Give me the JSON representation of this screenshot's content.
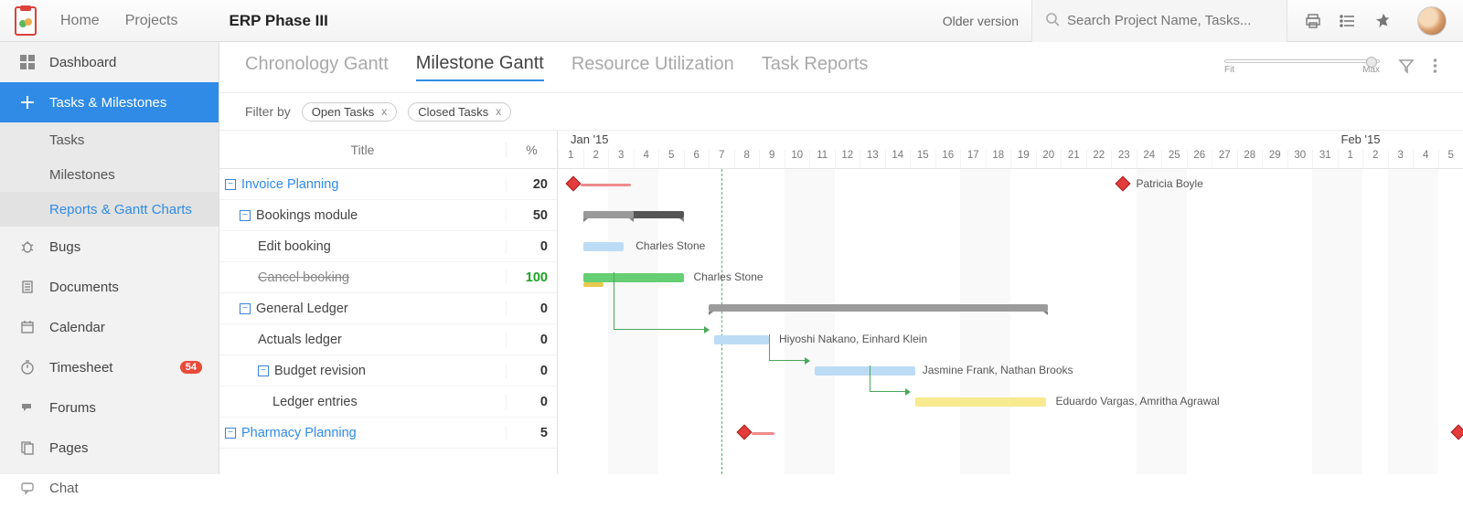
{
  "nav": {
    "home": "Home",
    "projects": "Projects"
  },
  "project_title": "ERP Phase III",
  "older_version": "Older version",
  "search": {
    "placeholder": "Search Project Name, Tasks..."
  },
  "sidebar": {
    "dashboard": "Dashboard",
    "tasks_milestones": "Tasks & Milestones",
    "tasks": "Tasks",
    "milestones": "Milestones",
    "reports_gantt": "Reports & Gantt Charts",
    "bugs": "Bugs",
    "documents": "Documents",
    "calendar": "Calendar",
    "timesheet": "Timesheet",
    "timesheet_badge": "54",
    "forums": "Forums",
    "pages": "Pages",
    "chat": "Chat"
  },
  "view_tabs": {
    "chronology": "Chronology Gantt",
    "milestone": "Milestone Gantt",
    "resource": "Resource Utilization",
    "task_reports": "Task Reports"
  },
  "zoom": {
    "fit": "Fit",
    "max": "Max"
  },
  "filters": {
    "label": "Filter by",
    "open_tasks": "Open Tasks",
    "closed_tasks": "Closed Tasks",
    "clear": "x"
  },
  "columns": {
    "title": "Title",
    "pct": "%"
  },
  "months": {
    "jan15": "Jan '15",
    "feb15": "Feb '15"
  },
  "rows": [
    {
      "depth": 0,
      "kind": "milestone",
      "title": "Invoice Planning",
      "pct": "20"
    },
    {
      "depth": 1,
      "kind": "group",
      "title": "Bookings module",
      "pct": "50"
    },
    {
      "depth": 2,
      "kind": "task",
      "title": "Edit booking",
      "pct": "0"
    },
    {
      "depth": 2,
      "kind": "done",
      "title": "Cancel booking",
      "pct": "100"
    },
    {
      "depth": 1,
      "kind": "group",
      "title": "General Ledger",
      "pct": "0"
    },
    {
      "depth": 2,
      "kind": "task",
      "title": "Actuals ledger",
      "pct": "0"
    },
    {
      "depth": 2,
      "kind": "group",
      "title": "Budget revision",
      "pct": "0"
    },
    {
      "depth": 3,
      "kind": "task",
      "title": "Ledger entries",
      "pct": "0"
    },
    {
      "depth": 0,
      "kind": "milestone",
      "title": "Pharmacy Planning",
      "pct": "5"
    }
  ],
  "assignees": {
    "patricia": "Patricia Boyle",
    "charles1": "Charles Stone",
    "charles2": "Charles Stone",
    "hiyoshi": "Hiyoshi Nakano, Einhard Klein",
    "jasmine": "Jasmine Frank, Nathan Brooks",
    "eduardo": "Eduardo Vargas, Amritha Agrawal"
  },
  "chart_data": {
    "type": "gantt",
    "days": [
      "1",
      "2",
      "3",
      "4",
      "5",
      "6",
      "7",
      "8",
      "9",
      "10",
      "11",
      "12",
      "13",
      "14",
      "15",
      "16",
      "17",
      "18",
      "19",
      "20",
      "21",
      "22",
      "23",
      "24",
      "25",
      "26",
      "27",
      "28",
      "29",
      "30",
      "31",
      "1",
      "2",
      "3",
      "4",
      "5"
    ],
    "today_day": 7,
    "rows": [
      {
        "title": "Invoice Planning",
        "type": "milestone",
        "diamond_at": 1,
        "progress_line": [
          1,
          3
        ],
        "milestone_end": 23,
        "label": "Patricia Boyle"
      },
      {
        "title": "Bookings module",
        "type": "group",
        "start": 2,
        "end": 5
      },
      {
        "title": "Edit booking",
        "type": "task",
        "start": 2,
        "end": 3,
        "color": "blue",
        "label": "Charles Stone"
      },
      {
        "title": "Cancel booking",
        "type": "task",
        "start": 2,
        "end": 5,
        "color": "green",
        "progress_line": [
          2,
          2.6
        ],
        "label": "Charles Stone"
      },
      {
        "title": "General Ledger",
        "type": "group",
        "start": 7,
        "end": 20
      },
      {
        "title": "Actuals ledger",
        "type": "task",
        "start": 7,
        "end": 8.5,
        "color": "blue",
        "label": "Hiyoshi Nakano, Einhard Klein"
      },
      {
        "title": "Budget revision",
        "type": "group",
        "start": 11,
        "end": 14.5,
        "color": "blue",
        "label": "Jasmine Frank, Nathan Brooks"
      },
      {
        "title": "Ledger entries",
        "type": "task",
        "start": 15,
        "end": 19.5,
        "color": "yellow",
        "label": "Eduardo Vargas, Amritha Agrawal"
      },
      {
        "title": "Pharmacy Planning",
        "type": "milestone",
        "diamond_at": 8,
        "progress_line": [
          8,
          9
        ]
      }
    ]
  }
}
